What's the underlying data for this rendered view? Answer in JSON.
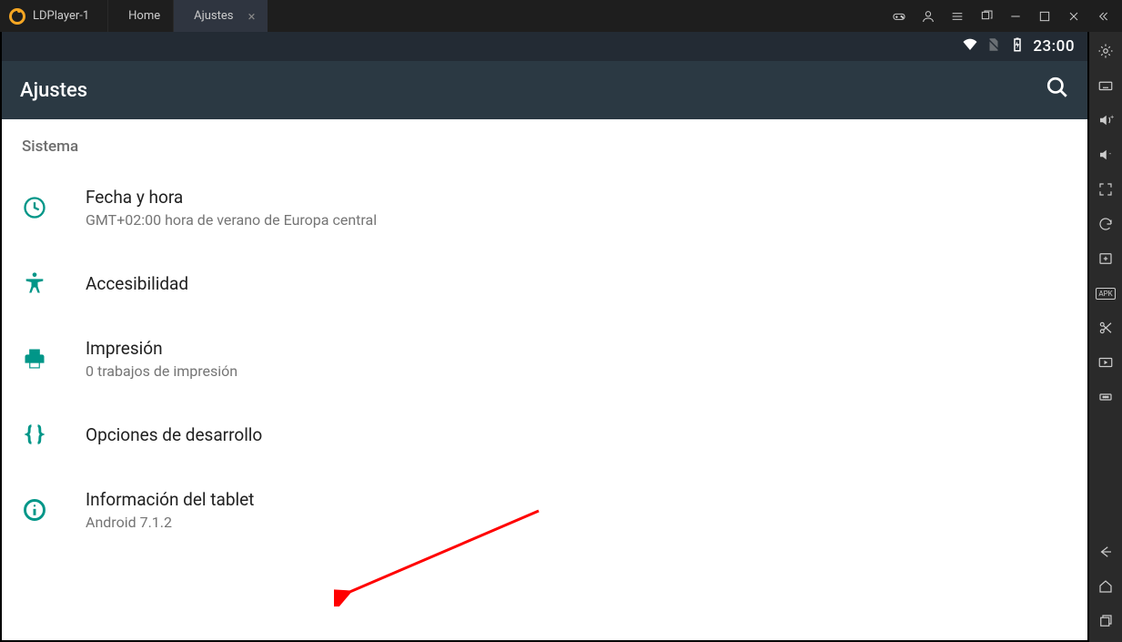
{
  "titlebar": {
    "app_name": "LDPlayer-1",
    "tabs": [
      {
        "label": "Home",
        "active": false,
        "icon": "home"
      },
      {
        "label": "Ajustes",
        "active": true,
        "icon": "gear"
      }
    ]
  },
  "statusbar": {
    "time": "23:00"
  },
  "appbar": {
    "title": "Ajustes"
  },
  "settings": {
    "section": "Sistema",
    "items": [
      {
        "icon": "clock",
        "title": "Fecha y hora",
        "sub": "GMT+02:00 hora de verano de Europa central"
      },
      {
        "icon": "accessibility",
        "title": "Accesibilidad",
        "sub": ""
      },
      {
        "icon": "print",
        "title": "Impresión",
        "sub": "0 trabajos de impresión"
      },
      {
        "icon": "braces",
        "title": "Opciones de desarrollo",
        "sub": ""
      },
      {
        "icon": "info",
        "title": "Información del tablet",
        "sub": "Android 7.1.2"
      }
    ]
  }
}
